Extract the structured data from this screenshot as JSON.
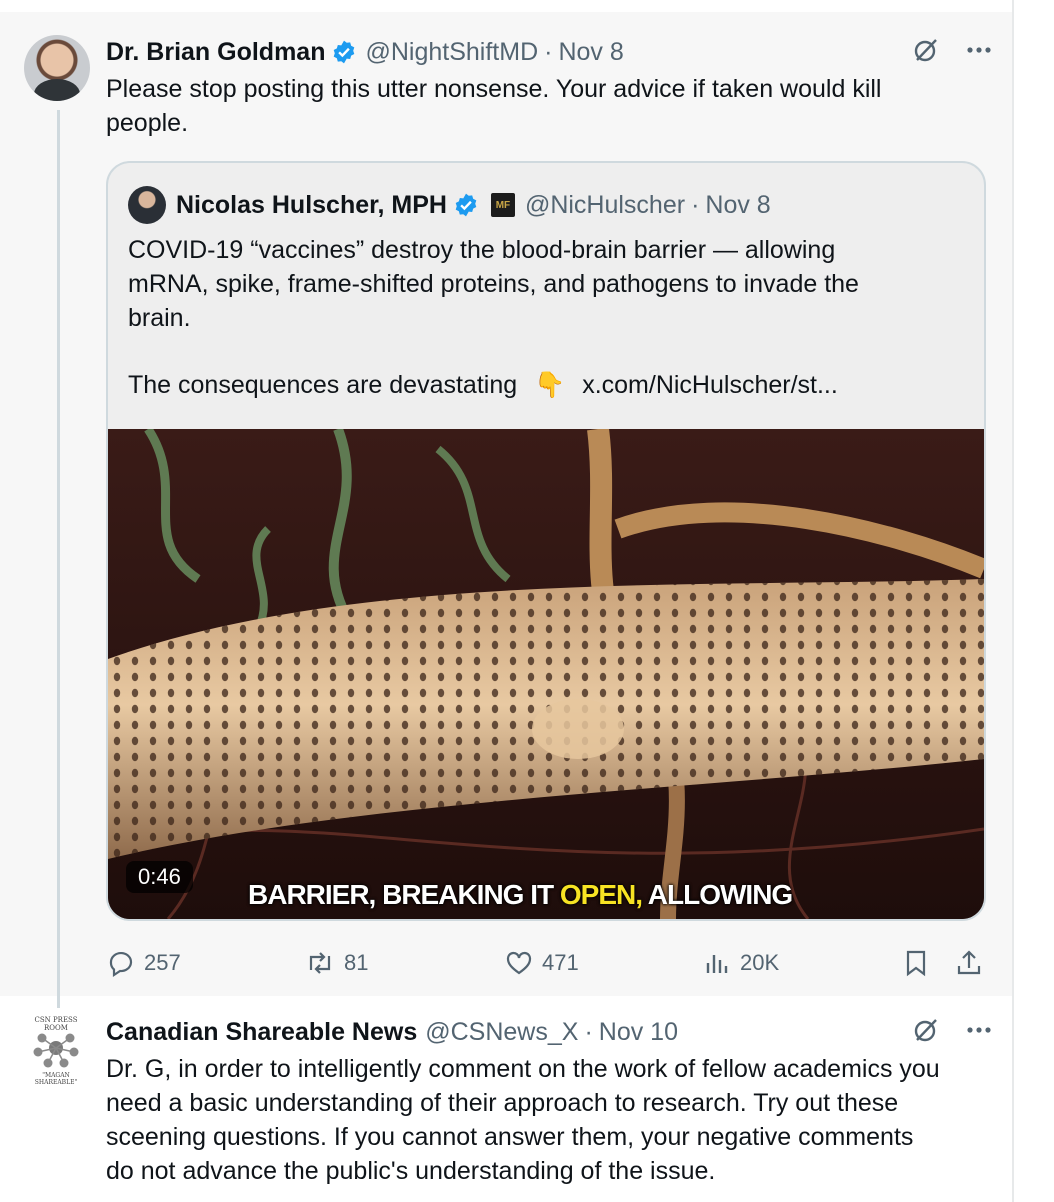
{
  "tweet1": {
    "author_name": "Dr. Brian Goldman",
    "handle": "@NightShiftMD",
    "separator": "·",
    "date": "Nov 8",
    "text_line1": "Please stop posting this utter nonsense. Your advice if taken would kill",
    "text_line2": "people.",
    "quote": {
      "author_name": "Nicolas Hulscher, MPH",
      "badge": "MF",
      "handle": "@NicHulscher",
      "separator": "·",
      "date": "Nov 8",
      "text_line1": "COVID-19 “vaccines” destroy the blood-brain barrier — allowing",
      "text_line2": "mRNA, spike, frame-shifted proteins, and pathogens to invade the",
      "text_line3": "brain.",
      "text_line4": "The consequences are devastating",
      "emoji": "👇",
      "link": "x.com/NicHulscher/st...",
      "media": {
        "duration": "0:46",
        "caption_part1": "BARRIER, BREAKING IT ",
        "caption_highlight": "OPEN,",
        "caption_part2": " ALLOWING",
        "highlight_color": "#f7e323"
      }
    },
    "stats": {
      "replies": "257",
      "reposts": "81",
      "likes": "471",
      "views": "20K"
    }
  },
  "tweet2": {
    "author_name": "Canadian Shareable News",
    "handle": "@CSNews_X",
    "separator": "·",
    "date": "Nov 10",
    "logo_top": "CSN PRESS ROOM",
    "logo_bottom": "\"MAGAN SHAREABLE\"",
    "text_line1": "Dr. G, in order to intelligently comment on the work of fellow academics you",
    "text_line2": "need a basic understanding of their approach to research. Try out these",
    "text_line3": "sceening questions. If you cannot answer them, your negative comments",
    "text_line4": "do not advance the public's understanding of the issue."
  },
  "colors": {
    "verified": "#1d9bf0",
    "secondary_text": "#536471",
    "primary_text": "#0f1419"
  },
  "icons": [
    "verified-badge-icon",
    "grok-icon",
    "more-icon",
    "reply-icon",
    "repost-icon",
    "like-icon",
    "views-icon",
    "bookmark-icon",
    "share-icon"
  ]
}
